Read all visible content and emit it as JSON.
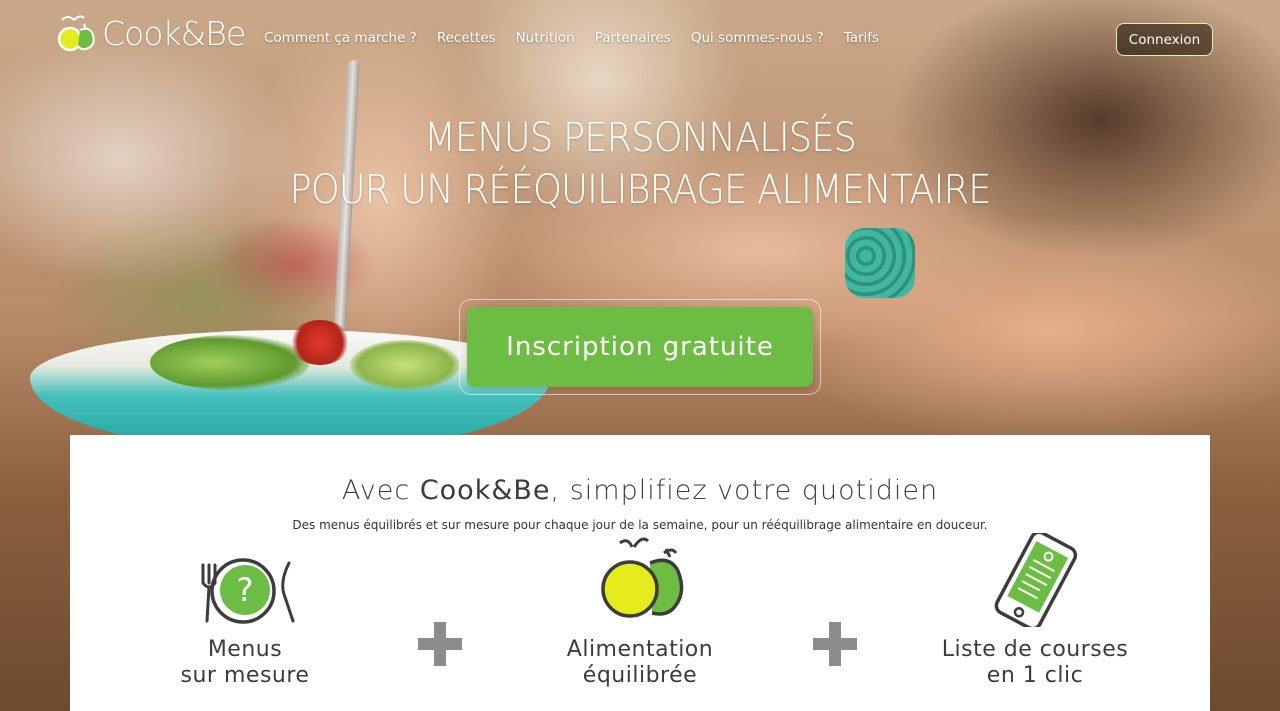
{
  "brand": {
    "name": "Cook&Be"
  },
  "nav": {
    "items": [
      {
        "label": "Comment ça marche ?"
      },
      {
        "label": "Recettes"
      },
      {
        "label": "Nutrition"
      },
      {
        "label": "Partenaires"
      },
      {
        "label": "Qui sommes-nous ?"
      },
      {
        "label": "Tarifs"
      }
    ],
    "login_label": "Connexion"
  },
  "hero": {
    "line1": "MENUS PERSONNALISÉS",
    "line2": "POUR UN RÉÉQUILIBRAGE ALIMENTAIRE",
    "cta_label": "Inscription gratuite"
  },
  "intro": {
    "title_prefix": "Avec ",
    "title_brand": "Cook&Be",
    "title_suffix": ", simplifiez votre quotidien",
    "subtitle": "Des menus équilibrés et sur mesure pour chaque jour de la semaine, pour un rééquilibrage alimentaire en douceur."
  },
  "features": [
    {
      "line1": "Menus",
      "line2": "sur mesure",
      "icon": "plate-question-icon"
    },
    {
      "line1": "Alimentation",
      "line2": "équilibrée",
      "icon": "apples-icon"
    },
    {
      "line1": "Liste de courses",
      "line2": "en 1 clic",
      "icon": "smartphone-list-icon"
    }
  ],
  "colors": {
    "accent_green": "#6dbd45",
    "logo_yellow": "#e4ec1e",
    "login_border": "#e6f0a8",
    "text_dark": "#3c3c3c",
    "plus_gray": "#8c8c8c"
  }
}
